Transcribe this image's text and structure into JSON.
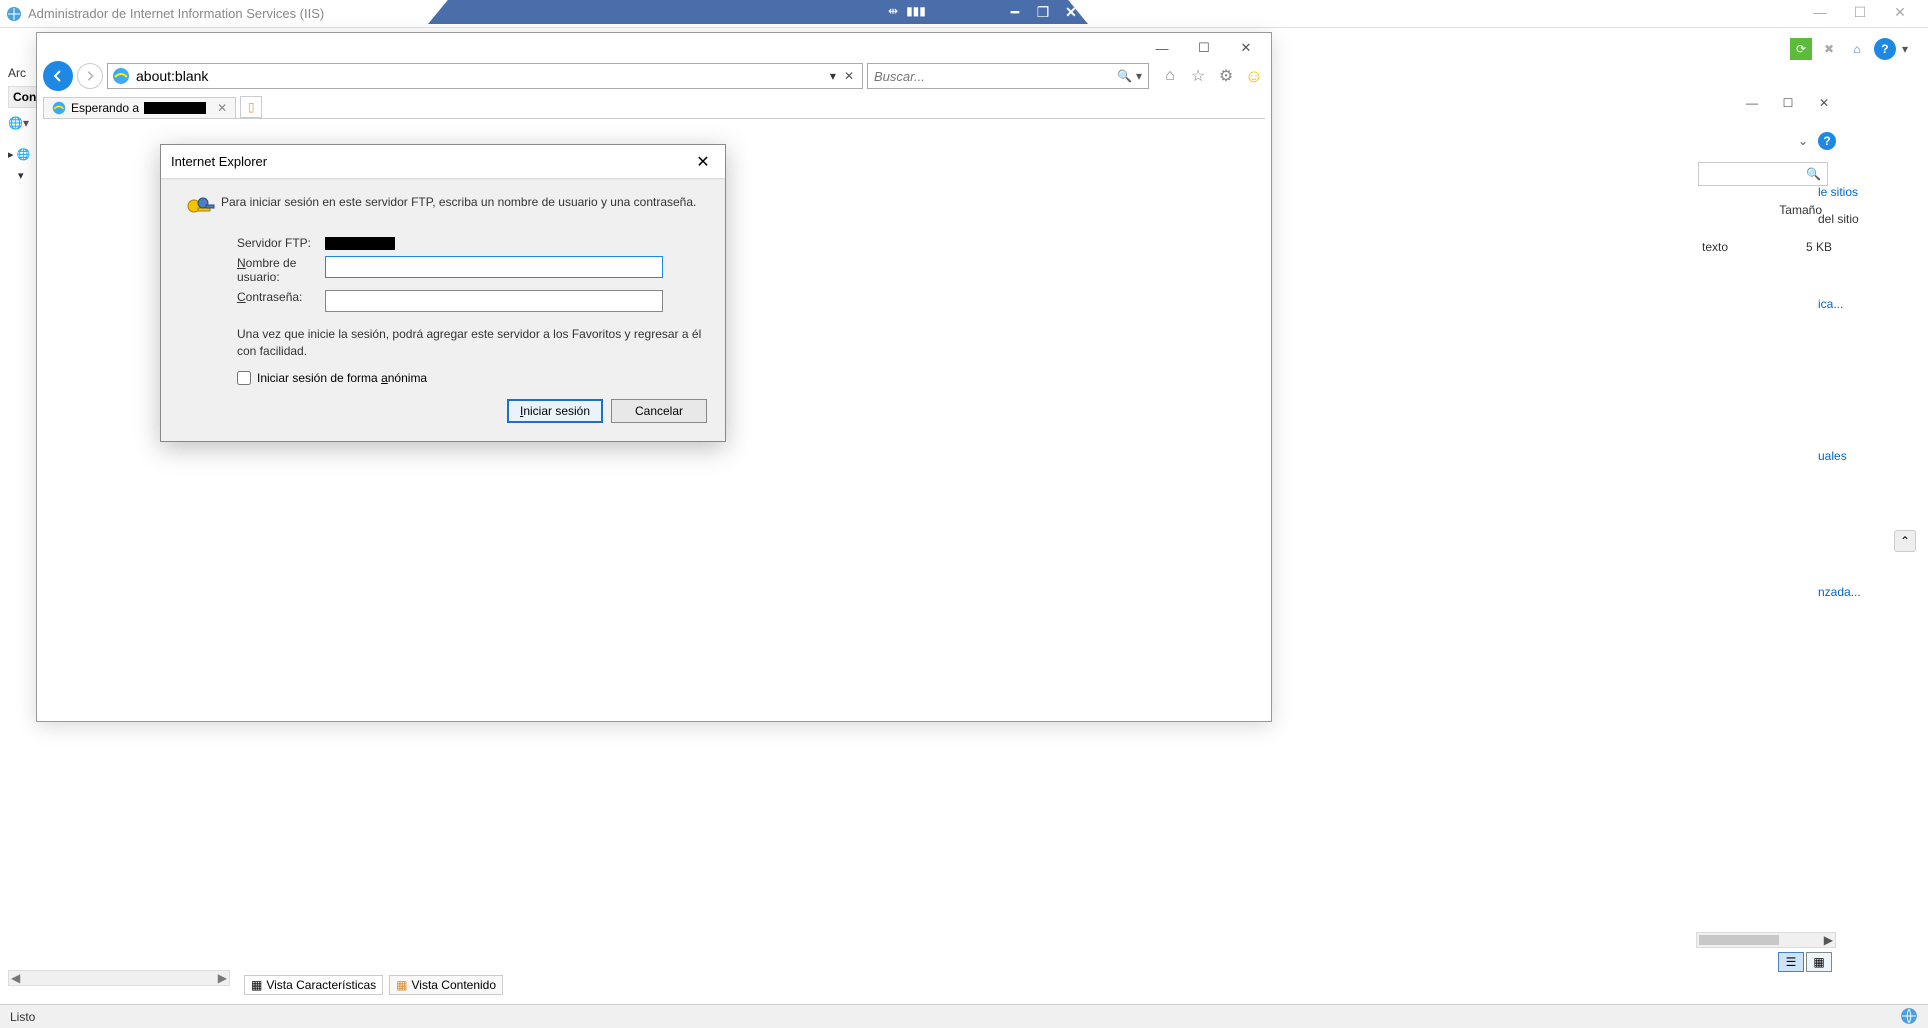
{
  "iis": {
    "title": "Administrador de Internet Information Services (IIS)",
    "menu_left": "Arc",
    "connections_header": "Con",
    "tabs": {
      "features": "Vista Características",
      "content": "Vista Contenido"
    },
    "status": "Listo"
  },
  "explorer_right": {
    "col_size": "Tamaño",
    "row_texto": "texto",
    "row_size": "5 KB",
    "links": {
      "sitios": "le sitios",
      "del_sitio": "del sitio",
      "ica": "ica...",
      "uales": "uales",
      "nzada": "nzada..."
    }
  },
  "ie": {
    "address": "about:blank",
    "search_placeholder": "Buscar...",
    "tab_label_prefix": "Esperando a ",
    "icons": {
      "home": "home",
      "favorites": "star",
      "settings": "gear",
      "feedback": "smiley"
    }
  },
  "dialog": {
    "title": "Internet Explorer",
    "message": "Para iniciar sesión en este servidor FTP, escriba un nombre de usuario y una contraseña.",
    "server_label": "Servidor FTP:",
    "server_value": "",
    "username_label_pre": "N",
    "username_label_post": "ombre de usuario:",
    "username_value": "",
    "password_label_pre": "C",
    "password_label_post": "ontraseña:",
    "password_value": "",
    "note": "Una vez que inicie la sesión, podrá agregar este servidor a los Favoritos y regresar a él con facilidad.",
    "anon_prefix": "Iniciar sesión de forma ",
    "anon_u": "a",
    "anon_suffix": "nónima",
    "login_u": "I",
    "login_rest": "niciar sesión",
    "cancel": "Cancelar"
  }
}
